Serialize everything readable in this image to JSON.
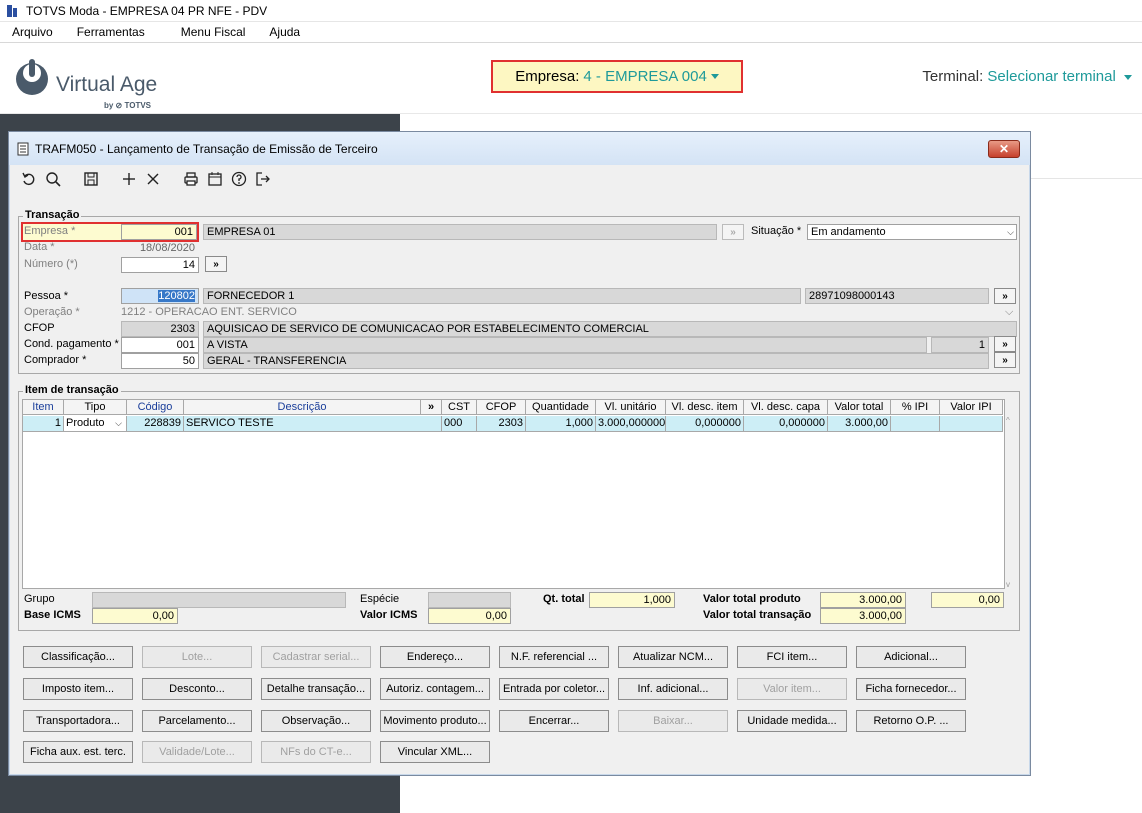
{
  "app": {
    "title": "TOTVS Moda - EMPRESA 04 PR NFE - PDV",
    "menu": [
      "Arquivo",
      "Ferramentas",
      "Menu Fiscal",
      "Ajuda"
    ],
    "logo_text": "Virtual Age",
    "logo_sub": "by ⊘ TOTVS",
    "empresa_label": "Empresa:",
    "empresa_value": "4 - EMPRESA 004",
    "terminal_label": "Terminal:",
    "terminal_value": "Selecionar terminal"
  },
  "dialog": {
    "title": "TRAFM050 - Lançamento de Transação de Emissão de Terceiro",
    "close_label": "✕",
    "toolbar_icons": [
      "undo-icon",
      "search-icon",
      "save-icon",
      "add-icon",
      "delete-icon",
      "print-icon",
      "calendar-icon",
      "help-icon",
      "exit-icon"
    ]
  },
  "transacao": {
    "title": "Transação",
    "empresa_label": "Empresa *",
    "empresa_code": "001",
    "empresa_name": "EMPRESA 01",
    "situacao_label": "Situação *",
    "situacao_value": "Em andamento",
    "data_label": "Data *",
    "data_value": "18/08/2020",
    "numero_label": "Número (*)",
    "numero_value": "14",
    "pessoa_label": "Pessoa *",
    "pessoa_code": "120802",
    "pessoa_name": "FORNECEDOR 1",
    "pessoa_doc": "28971098000143",
    "operacao_label": "Operação *",
    "operacao_value": "1212 - OPERACAO ENT. SERVICO",
    "cfop_label": "CFOP",
    "cfop_code": "2303",
    "cfop_desc": "AQUISICAO DE SERVICO DE COMUNICACAO POR ESTABELECIMENTO COMERCIAL",
    "cond_label": "Cond. pagamento *",
    "cond_code": "001",
    "cond_desc": "A VISTA",
    "cond_parcelas": "1",
    "comprador_label": "Comprador *",
    "comprador_code": "50",
    "comprador_desc": "GERAL - TRANSFERENCIA",
    "more_button": "»"
  },
  "itens": {
    "title": "Item de transação",
    "columns": [
      "Item",
      "Tipo",
      "Código",
      "Descrição",
      "»",
      "CST",
      "CFOP",
      "Quantidade",
      "Vl. unitário",
      "Vl. desc. item",
      "Vl. desc. capa",
      "Valor total",
      "% IPI",
      "Valor IPI"
    ],
    "rows": [
      [
        "1",
        "Produto",
        "228839",
        "SERVICO TESTE",
        "",
        "000",
        "2303",
        "1,000",
        "3.000,000000",
        "0,000000",
        "0,000000",
        "3.000,00",
        "",
        ""
      ]
    ]
  },
  "totais": {
    "grupo_label": "Grupo",
    "especie_label": "Espécie",
    "qt_total_label": "Qt. total",
    "qt_total_value": "1,000",
    "valor_total_produto_label": "Valor total produto",
    "valor_total_produto_value": "3.000,00",
    "ipi_total_value": "0,00",
    "base_icms_label": "Base ICMS",
    "base_icms_value": "0,00",
    "valor_icms_label": "Valor ICMS",
    "valor_icms_value": "0,00",
    "valor_total_transacao_label": "Valor total transação",
    "valor_total_transacao_value": "3.000,00"
  },
  "buttons": [
    {
      "label": "Classificação...",
      "enabled": true
    },
    {
      "label": "Lote...",
      "enabled": false
    },
    {
      "label": "Cadastrar serial...",
      "enabled": false
    },
    {
      "label": "Endereço...",
      "enabled": true
    },
    {
      "label": "N.F. referencial ...",
      "enabled": true
    },
    {
      "label": "Atualizar NCM...",
      "enabled": true
    },
    {
      "label": "FCI item...",
      "enabled": true
    },
    {
      "label": "Adicional...",
      "enabled": true
    },
    {
      "label": "Imposto item...",
      "enabled": true
    },
    {
      "label": "Desconto...",
      "enabled": true
    },
    {
      "label": "Detalhe transação...",
      "enabled": true
    },
    {
      "label": "Autoriz. contagem...",
      "enabled": true
    },
    {
      "label": "Entrada por coletor...",
      "enabled": true
    },
    {
      "label": "Inf. adicional...",
      "enabled": true
    },
    {
      "label": "Valor item...",
      "enabled": false
    },
    {
      "label": "Ficha fornecedor...",
      "enabled": true
    },
    {
      "label": "Transportadora...",
      "enabled": true
    },
    {
      "label": "Parcelamento...",
      "enabled": true
    },
    {
      "label": "Observação...",
      "enabled": true
    },
    {
      "label": "Movimento produto...",
      "enabled": true
    },
    {
      "label": "Encerrar...",
      "enabled": true
    },
    {
      "label": "Baixar...",
      "enabled": false
    },
    {
      "label": "Unidade medida...",
      "enabled": true
    },
    {
      "label": "Retorno O.P. ...",
      "enabled": true
    },
    {
      "label": "Ficha aux. est. terc.",
      "enabled": true
    },
    {
      "label": "Validade/Lote...",
      "enabled": false
    },
    {
      "label": "NFs do CT-e...",
      "enabled": false
    },
    {
      "label": "Vincular XML...",
      "enabled": true
    }
  ]
}
